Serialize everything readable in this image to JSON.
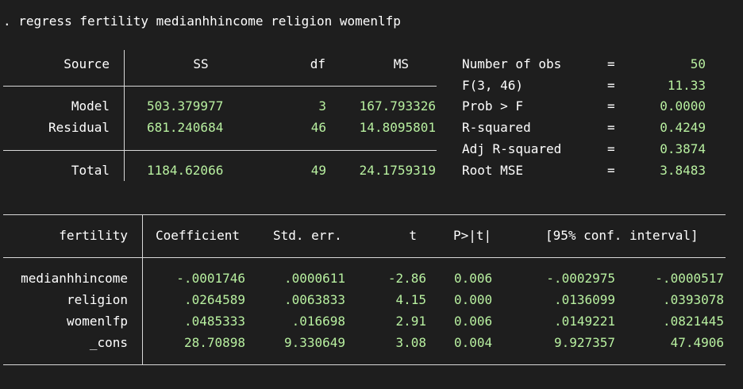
{
  "console": {
    "command": ". regress fertility medianhhincome religion womenlfp"
  },
  "anova": {
    "headers": {
      "source": "Source",
      "ss": "SS",
      "df": "df",
      "ms": "MS"
    },
    "rows": [
      {
        "source": "Model",
        "ss": "503.379977",
        "df": "3",
        "ms": "167.793326"
      },
      {
        "source": "Residual",
        "ss": "681.240684",
        "df": "46",
        "ms": "14.8095801"
      },
      {
        "source": "Total",
        "ss": "1184.62066",
        "df": "49",
        "ms": "24.1759319"
      }
    ]
  },
  "stats": [
    {
      "label": "Number of obs",
      "eq": "=",
      "value": "50"
    },
    {
      "label": "F(3, 46)",
      "eq": "=",
      "value": "11.33"
    },
    {
      "label": "Prob > F",
      "eq": "=",
      "value": "0.0000"
    },
    {
      "label": "R-squared",
      "eq": "=",
      "value": "0.4249"
    },
    {
      "label": "Adj R-squared",
      "eq": "=",
      "value": "0.3874"
    },
    {
      "label": "Root MSE",
      "eq": "=",
      "value": "3.8483"
    }
  ],
  "coef": {
    "headers": {
      "depvar": "fertility",
      "coef": "Coefficient",
      "se": "Std. err.",
      "t": "t",
      "p": "P>|t|",
      "ci": "[95% conf. interval]"
    },
    "rows": [
      {
        "var": "medianhhincome",
        "coef": "-.0001746",
        "se": ".0000611",
        "t": "-2.86",
        "p": "0.006",
        "lo": "-.0002975",
        "hi": "-.0000517"
      },
      {
        "var": "religion",
        "coef": ".0264589",
        "se": ".0063833",
        "t": "4.15",
        "p": "0.000",
        "lo": ".0136099",
        "hi": ".0393078"
      },
      {
        "var": "womenlfp",
        "coef": ".0485333",
        "se": ".016698",
        "t": "2.91",
        "p": "0.006",
        "lo": ".0149221",
        "hi": ".0821445"
      },
      {
        "var": "_cons",
        "coef": "28.70898",
        "se": "9.330649",
        "t": "3.08",
        "p": "0.004",
        "lo": "9.927357",
        "hi": "47.4906"
      }
    ]
  }
}
